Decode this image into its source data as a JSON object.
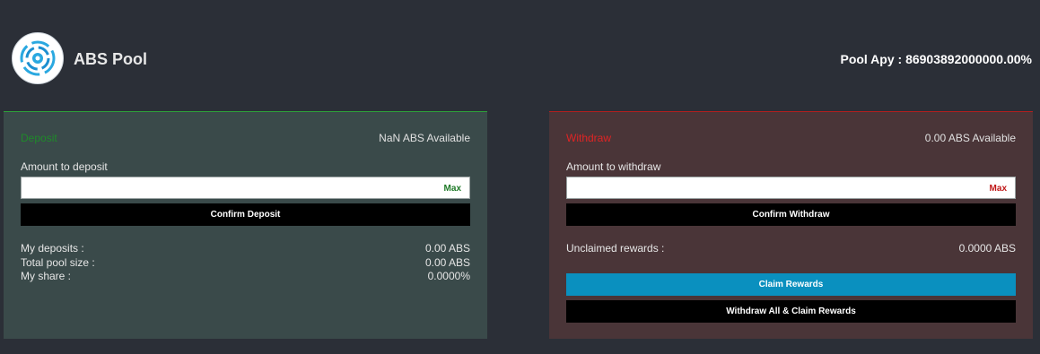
{
  "header": {
    "logo_icon": "abs-swirl-logo-icon",
    "title": "ABS Pool",
    "apy_text": "Pool Apy : 86903892000000.00%"
  },
  "deposit": {
    "tab_label": "Deposit",
    "available": "NaN ABS Available",
    "amount_label": "Amount to deposit",
    "input_value": "",
    "input_placeholder": "",
    "max_label": "Max",
    "confirm_label": "Confirm Deposit",
    "stats": [
      {
        "label": "My deposits :",
        "value": "0.00 ABS"
      },
      {
        "label": "Total pool size :",
        "value": "0.00 ABS"
      },
      {
        "label": "My share :",
        "value": "0.0000%"
      }
    ],
    "accent_color": "#1f8a2a"
  },
  "withdraw": {
    "tab_label": "Withdraw",
    "available": "0.00 ABS Available",
    "amount_label": "Amount to withdraw",
    "input_value": "",
    "input_placeholder": "",
    "max_label": "Max",
    "confirm_label": "Confirm Withdraw",
    "unclaimed_label": "Unclaimed rewards :",
    "unclaimed_value": "0.0000 ABS",
    "claim_label": "Claim Rewards",
    "withdraw_all_label": "Withdraw All & Claim Rewards",
    "accent_color": "#e02424"
  },
  "colors": {
    "background": "#2b2f37",
    "deposit_panel": "#3a4a4a",
    "withdraw_panel": "#4a3538",
    "claim_button": "#0a90bf"
  }
}
